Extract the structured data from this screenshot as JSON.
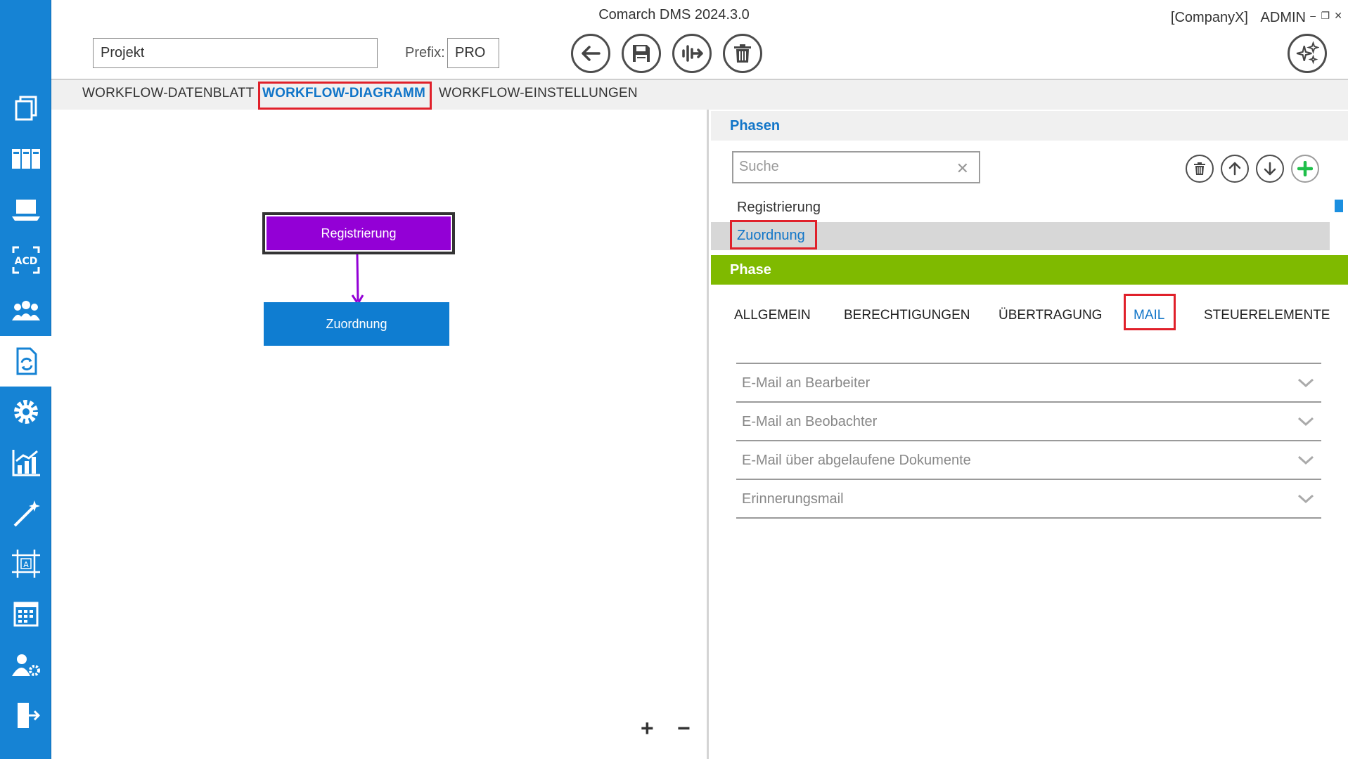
{
  "app": {
    "title": "Comarch DMS 2024.3.0",
    "company": "[CompanyX]",
    "user": "ADMIN",
    "win_min": "–",
    "win_max": "❐",
    "win_close": "✕"
  },
  "header": {
    "name_value": "Projekt",
    "prefix_label": "Prefix:",
    "prefix_value": "PRO"
  },
  "tabs": [
    {
      "label": "WORKFLOW-DATENBLATT"
    },
    {
      "label": "WORKFLOW-DIAGRAMM"
    },
    {
      "label": "WORKFLOW-EINSTELLUNGEN"
    }
  ],
  "diagram": {
    "nodes": [
      {
        "label": "Registrierung",
        "color": "#9300d6"
      },
      {
        "label": "Zuordnung",
        "color": "#0f7dd1"
      }
    ],
    "zoom_in": "+",
    "zoom_out": "−"
  },
  "phasen": {
    "title": "Phasen",
    "search_placeholder": "Suche",
    "list": [
      "Registrierung",
      "Zuordnung"
    ]
  },
  "phase": {
    "title": "Phase",
    "tabs": [
      "ALLGEMEIN",
      "BERECHTIGUNGEN",
      "ÜBERTRAGUNG",
      "MAIL",
      "STEUERELEMENTE"
    ],
    "mail_sections": [
      "E-Mail an Bearbeiter",
      "E-Mail an Beobachter",
      "E-Mail über abgelaufene Dokumente",
      "Erinnerungsmail"
    ]
  },
  "colors": {
    "sidebar": "#1683d4",
    "accent": "#1175c8",
    "phase_bar": "#7fba00",
    "highlight": "#e0202a"
  }
}
